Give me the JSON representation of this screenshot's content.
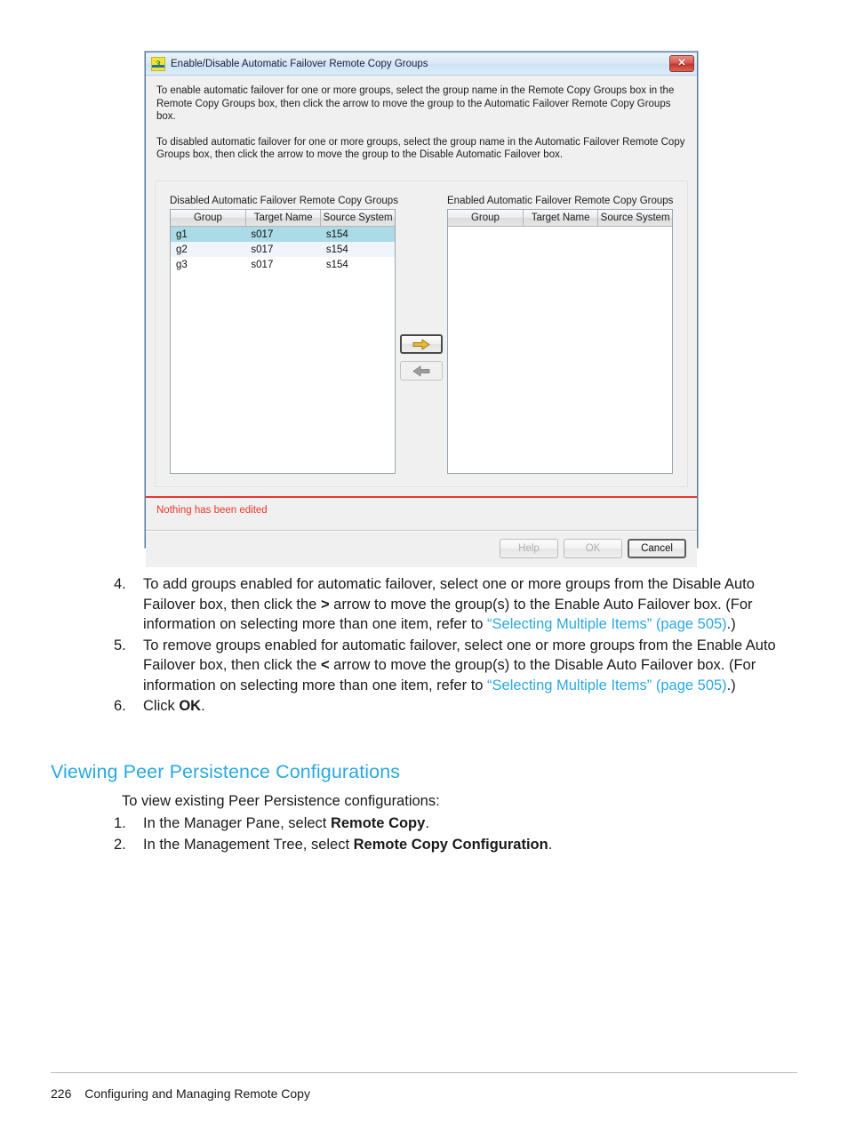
{
  "dialog": {
    "title": "Enable/Disable Automatic Failover Remote Copy Groups",
    "app_icon": "3par-icon",
    "close_label": "✕",
    "intro_paragraph_1": "To enable automatic failover for one or more groups, select the group name in the Remote Copy Groups box in the Remote Copy Groups box, then click the arrow to move the group to the Automatic Failover Remote Copy Groups box.",
    "intro_paragraph_2": "To disabled automatic failover for one or more groups, select the group name in the Automatic Failover Remote Copy Groups box, then click the arrow to move the group to the Disable Automatic Failover box.",
    "left_list": {
      "label": "Disabled Automatic Failover Remote Copy Groups",
      "columns": [
        "Group",
        "Target Name",
        "Source System"
      ],
      "rows": [
        {
          "group": "g1",
          "target_name": "s017",
          "source_system": "s154",
          "selected": true
        },
        {
          "group": "g2",
          "target_name": "s017",
          "source_system": "s154",
          "selected": false
        },
        {
          "group": "g3",
          "target_name": "s017",
          "source_system": "s154",
          "selected": false
        }
      ]
    },
    "right_list": {
      "label": "Enabled Automatic Failover Remote Copy Groups",
      "columns": [
        "Group",
        "Target Name",
        "Source System"
      ],
      "rows": []
    },
    "move_right_button": "right-arrow",
    "move_left_button": "left-arrow",
    "status_message": "Nothing has been edited",
    "buttons": {
      "help": "Help",
      "ok": "OK",
      "cancel": "Cancel"
    },
    "colors": {
      "status_red": "#e8382c",
      "selection_cyan": "#aadbe6",
      "arrow_gold": "#e8b93a",
      "arrow_gray": "#8c8c8c"
    }
  },
  "document": {
    "steps_upper": [
      {
        "num": "4.",
        "part1": "To add groups enabled for automatic failover, select one or more groups from the Disable Auto Failover box, then click the ",
        "symbol": ">",
        "part2": " arrow to move the group(s) to the Enable Auto Failover box. (For information on selecting more than one item, refer to ",
        "link": "“Selecting Multiple Items” (page 505)",
        "part3": ".)"
      },
      {
        "num": "5.",
        "part1": "To remove groups enabled for automatic failover, select one or more groups from the Enable Auto Failover box, then click the ",
        "symbol": "<",
        "part2": " arrow to move the group(s) to the Disable Auto Failover box. (For information on selecting more than one item, refer to ",
        "link": "“Selecting Multiple Items” (page 505)",
        "part3": ".)"
      }
    ],
    "step_six": {
      "num": "6.",
      "part1": "Click ",
      "bold": "OK",
      "part2": "."
    },
    "section_heading": "Viewing Peer Persistence Configurations",
    "lead_in": "To view existing Peer Persistence configurations:",
    "steps_lower": [
      {
        "num": "1.",
        "part1": "In the Manager Pane, select ",
        "bold": "Remote Copy",
        "part2": "."
      },
      {
        "num": "2.",
        "part1": "In the Management Tree, select ",
        "bold": "Remote Copy Configuration",
        "part2": "."
      }
    ],
    "footer": {
      "page_number": "226",
      "chapter": "Configuring and Managing Remote Copy"
    },
    "colors": {
      "heading_blue": "#2aa8e0",
      "link_blue": "#2aa8e0"
    }
  }
}
